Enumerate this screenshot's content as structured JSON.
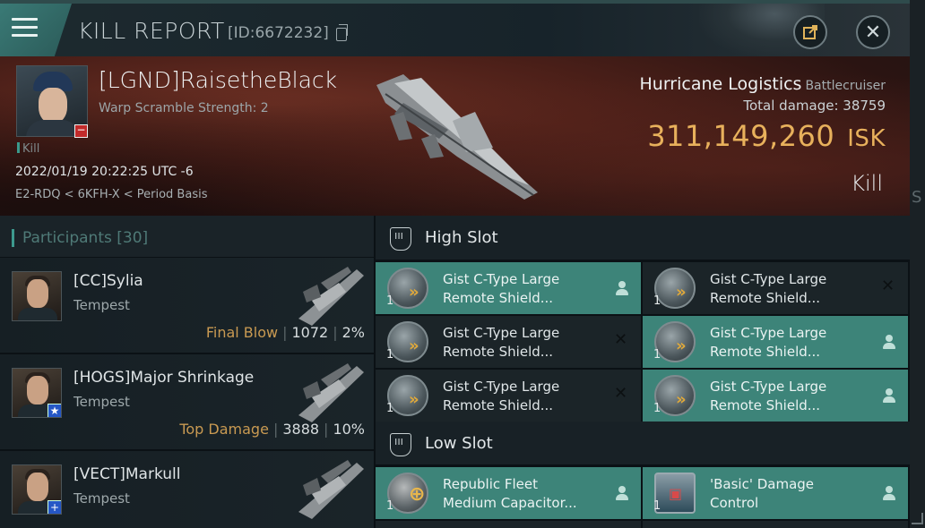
{
  "header": {
    "title": "KILL REPORT",
    "id_label": "[ID:6672232]"
  },
  "victim": {
    "name": "[LGND]RaisetheBlack",
    "scramble": "Warp Scramble Strength: 2",
    "kill_tag": "Kill",
    "date": "2022/01/19 20:22:25 UTC -6",
    "location": "E2-RDQ < 6KFH-X < Period Basis",
    "ship": "Hurricane Logistics",
    "ship_class": "Battlecruiser",
    "total_damage_label": "Total damage:",
    "total_damage": "38759",
    "isk_value": "311,149,260",
    "isk_unit": "ISK",
    "result": "Kill"
  },
  "participants": {
    "header": "Participants [30]",
    "rows": [
      {
        "name": "[CC]Sylia",
        "ship": "Tempest",
        "tag": "Final Blow",
        "damage": "1072",
        "percent": "2%"
      },
      {
        "name": "[HOGS]Major Shrinkage",
        "ship": "Tempest",
        "tag": "Top Damage",
        "damage": "3888",
        "percent": "10%"
      },
      {
        "name": "[VECT]Markull",
        "ship": "Tempest",
        "tag": "",
        "damage": "",
        "percent": ""
      }
    ]
  },
  "fittings": {
    "high_slot": {
      "label": "High Slot",
      "modules": [
        {
          "qty": "1",
          "line1": "Gist C-Type Large",
          "line2": "Remote Shield...",
          "status": "dropped"
        },
        {
          "qty": "1",
          "line1": "Gist C-Type Large",
          "line2": "Remote Shield...",
          "status": "destroyed"
        },
        {
          "qty": "1",
          "line1": "Gist C-Type Large",
          "line2": "Remote Shield...",
          "status": "destroyed"
        },
        {
          "qty": "1",
          "line1": "Gist C-Type Large",
          "line2": "Remote Shield...",
          "status": "dropped"
        },
        {
          "qty": "1",
          "line1": "Gist C-Type Large",
          "line2": "Remote Shield...",
          "status": "destroyed"
        },
        {
          "qty": "1",
          "line1": "Gist C-Type Large",
          "line2": "Remote Shield...",
          "status": "dropped"
        }
      ]
    },
    "low_slot": {
      "label": "Low Slot",
      "modules": [
        {
          "qty": "1",
          "line1": "Republic Fleet",
          "line2": "Medium Capacitor...",
          "status": "dropped"
        },
        {
          "qty": "1",
          "line1": "'Basic' Damage",
          "line2": "Control",
          "status": "dropped"
        }
      ]
    }
  },
  "colors": {
    "accent": "#3d8479",
    "isk": "#e8b15c",
    "final_blow": "#c99a52"
  }
}
